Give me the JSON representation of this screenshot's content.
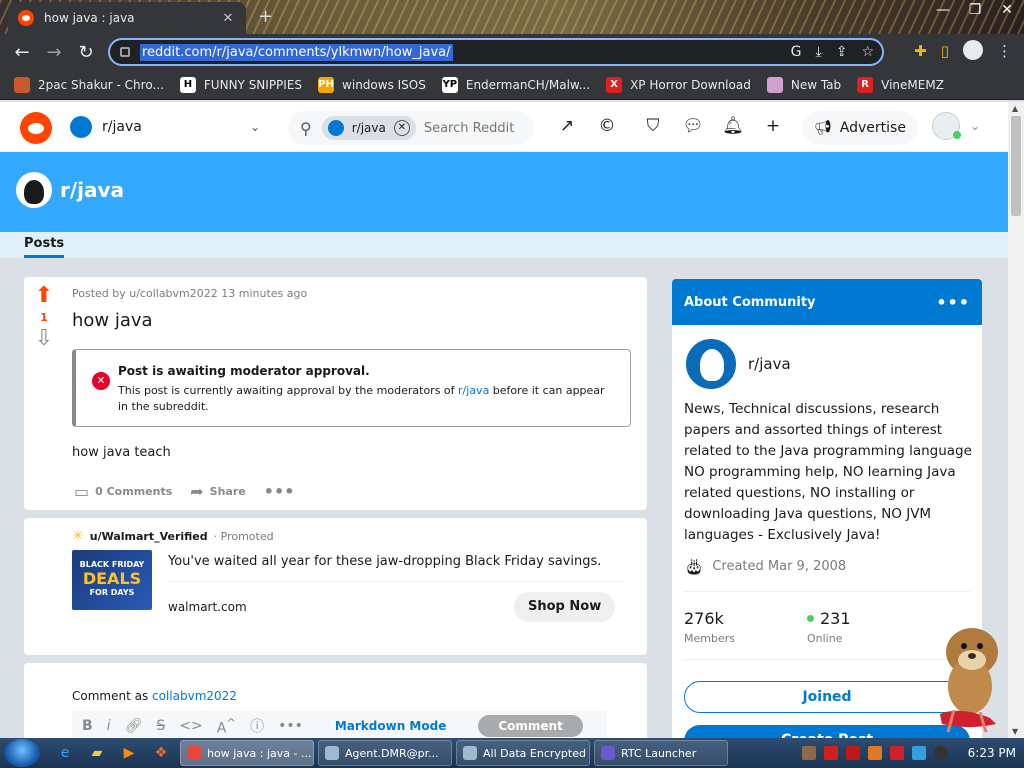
{
  "browser": {
    "tab_title": "how java : java",
    "tab_close": "✕",
    "new_tab": "+",
    "url": "reddit.com/r/java/comments/ylkmwn/how_java/",
    "bookmarks": [
      {
        "label": "2pac Shakur - Chro...",
        "color": "#c85a2b",
        "glyph": ""
      },
      {
        "label": "FUNNY SNIPPIES",
        "color": "#ffffff",
        "glyph": "H"
      },
      {
        "label": "windows ISOS",
        "color": "#f7a600",
        "glyph": "PH"
      },
      {
        "label": "EndermanCH/Malw...",
        "color": "#ffffff",
        "glyph": "YP"
      },
      {
        "label": "XP Horror Download",
        "color": "#e02020",
        "glyph": "X"
      },
      {
        "label": "New Tab",
        "color": "#d0a0d0",
        "glyph": ""
      },
      {
        "label": "VineMEMZ",
        "color": "#e02020",
        "glyph": "R"
      }
    ]
  },
  "reddit_header": {
    "community": "r/java",
    "search_chip": "r/java",
    "search_placeholder": "Search Reddit",
    "advertise_label": "Advertise"
  },
  "banner": {
    "name": "r/java",
    "tab_posts": "Posts"
  },
  "post": {
    "score": "1",
    "meta": "Posted by u/collabvm2022 13 minutes ago",
    "title": "how java",
    "mod_title": "Post is awaiting moderator approval.",
    "mod_body_pre": "This post is currently awaiting approval by the moderators of ",
    "mod_body_link": "r/java",
    "mod_body_post": " before it can appear in the subreddit.",
    "body": "how java teach",
    "comments_label": "0 Comments",
    "share_label": "Share"
  },
  "promo": {
    "user": "u/Walmart_Verified",
    "promoted": "Promoted",
    "thumb_line1": "BLACK FRIDAY",
    "thumb_line2": "DEALS",
    "thumb_line3": "FOR DAYS",
    "text": "You've waited all year for these jaw-dropping Black Friday savings.",
    "domain": "walmart.com",
    "cta": "Shop Now"
  },
  "comment": {
    "as_prefix": "Comment as ",
    "as_user": "collabvm2022",
    "markdown_mode": "Markdown Mode",
    "comment_btn": "Comment"
  },
  "about": {
    "header": "About Community",
    "name": "r/java",
    "description": "News, Technical discussions, research papers and assorted things of interest related to the Java programming language NO programming help, NO learning Java related questions, NO installing or downloading Java questions, NO JVM languages - Exclusively Java!",
    "created": "Created Mar 9, 2008",
    "members_num": "276k",
    "members_lbl": "Members",
    "online_num": "231",
    "online_lbl": "Online",
    "joined": "Joined",
    "create_post": "Create Post"
  },
  "taskbar": {
    "buttons": [
      {
        "label": "how java : java - ...",
        "color": "#e8453c",
        "active": true
      },
      {
        "label": "Agent.DMR@pr...",
        "color": "#a0b8d0",
        "active": false
      },
      {
        "label": "All Data Encrypted",
        "color": "#a0b8d0",
        "active": false
      },
      {
        "label": "RTC Launcher",
        "color": "#6a5acd",
        "active": false
      }
    ],
    "clock": "6:23 PM"
  },
  "colors": {
    "reddit_orange": "#ff4500",
    "reddit_blue": "#0079d3",
    "banner_blue": "#33a8ff"
  }
}
